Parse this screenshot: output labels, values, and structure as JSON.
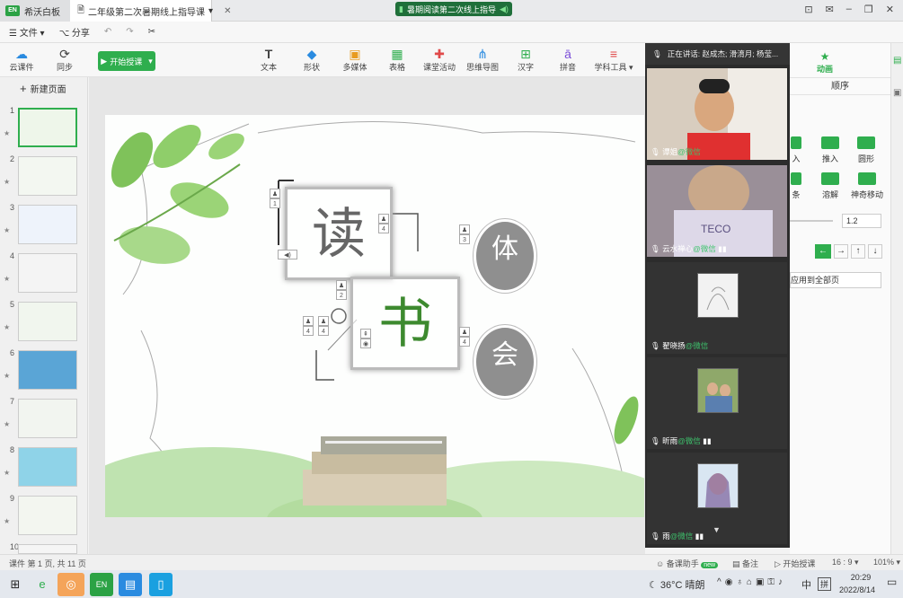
{
  "titlebar": {
    "app_name": "希沃白板",
    "doc_title": "二年级第二次暑期线上指导课",
    "meeting_title": "暑期阅读第二次线上指导"
  },
  "toolbar1": {
    "file": "文件",
    "share": "分享"
  },
  "toolbar2": {
    "cloud": "云课件",
    "sync": "同步",
    "start": "开始授课",
    "text": "文本",
    "shape": "形状",
    "media": "多媒体",
    "table": "表格",
    "activity": "课堂活动",
    "mindmap": "思维导图",
    "hanzi": "汉字",
    "pinyin": "拼音",
    "subject": "学科工具"
  },
  "sidebar": {
    "new_page": "新建页面",
    "pages": [
      "1",
      "2",
      "3",
      "4",
      "5",
      "6",
      "7",
      "8",
      "9",
      "10"
    ]
  },
  "slide": {
    "char_du": "读",
    "char_shu": "书",
    "char_ti": "体",
    "char_hui": "会",
    "anim_1": "1",
    "anim_2": "2",
    "anim_3": "3",
    "anim_4": "4"
  },
  "video": {
    "speaking": "正在讲话: 赵成杰; 滑淯月; 杨莹...",
    "participants": [
      {
        "name": "谭姐",
        "suffix": "@微信"
      },
      {
        "name": "云水禅心",
        "suffix": "@微信"
      },
      {
        "name": "翟晓扬",
        "suffix": "@微信"
      },
      {
        "name": "昕雨",
        "suffix": "@微信"
      },
      {
        "name": "雨",
        "suffix": "@微信"
      }
    ]
  },
  "rightpanel": {
    "tab_anim": "动画",
    "tab_order": "顺序",
    "item1": "入",
    "item2": "推入",
    "item3": "圆形",
    "item4": "条",
    "item5": "溶解",
    "item6": "神奇移动",
    "duration": "1.2",
    "apply_all": "应用到全部页"
  },
  "statusbar": {
    "page_info": "课件 第 1 页, 共 11 页",
    "assistant": "备课助手",
    "new_badge": "new",
    "notes": "备注",
    "start": "开始授课",
    "ratio": "16 : 9",
    "zoom": "101%"
  },
  "taskbar": {
    "weather": "36°C 晴朗",
    "ime": "中",
    "ime2": "拼",
    "time": "20:29",
    "date": "2022/8/14"
  },
  "colors": {
    "green": "#2fae4e",
    "dark_green": "#3d8a2f",
    "panel": "#2c2c2c"
  }
}
